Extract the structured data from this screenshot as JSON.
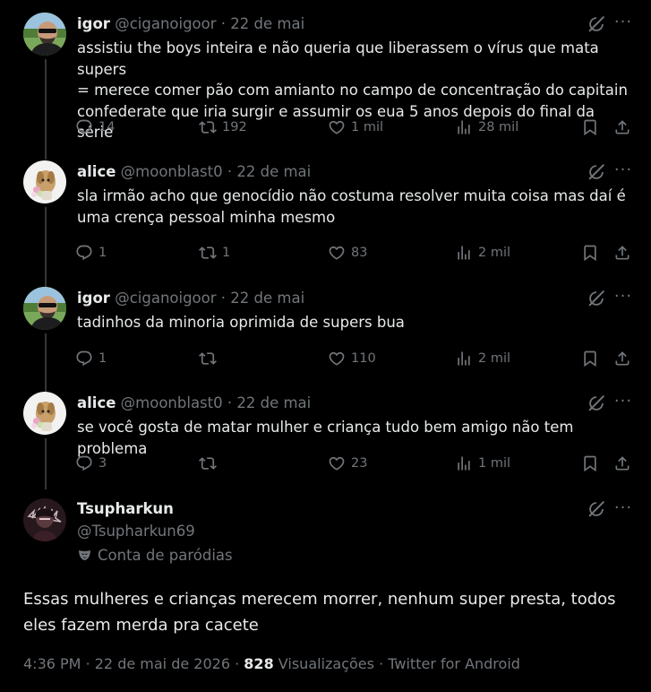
{
  "replies": [
    {
      "name": "igor",
      "handle": "@ciganoigoor",
      "dot": "·",
      "date": "22 de mai",
      "avatar": "avatar-igor",
      "lines": [
        "assistiu the boys inteira e não queria que liberassem o vírus que mata supers",
        "= merece comer pão com amianto no campo de concentração do capitain",
        "confederate que iria surgir e assumir os eua 5 anos depois do final da série"
      ],
      "replies_count": "14",
      "reposts": "192",
      "likes": "1 mil",
      "views": "28 mil"
    },
    {
      "name": "alice",
      "handle": "@moonblast0",
      "dot": "·",
      "date": "22 de mai",
      "avatar": "avatar-alice",
      "lines": [
        "sla irmão acho que genocídio não costuma resolver muita coisa mas daí é",
        "uma crença pessoal minha mesmo"
      ],
      "replies_count": "1",
      "reposts": "1",
      "likes": "83",
      "views": "2 mil"
    },
    {
      "name": "igor",
      "handle": "@ciganoigoor",
      "dot": "·",
      "date": "22 de mai",
      "avatar": "avatar-igor",
      "lines": [
        "tadinhos da minoria oprimida de supers bua"
      ],
      "replies_count": "1",
      "reposts": "",
      "likes": "110",
      "views": "2 mil"
    },
    {
      "name": "alice",
      "handle": "@moonblast0",
      "dot": "·",
      "date": "22 de mai",
      "avatar": "avatar-alice",
      "lines": [
        "se você gosta de matar mulher e criança tudo bem amigo não tem problema"
      ],
      "replies_count": "3",
      "reposts": "",
      "likes": "23",
      "views": "1 mil"
    }
  ],
  "main": {
    "name": "Tsupharkun",
    "handle": "@Tsupharkun69",
    "parody_label": "Conta de paródias",
    "text_lines": [
      "Essas mulheres e crianças merecem morrer, nenhum super presta, todos",
      "eles fazem merda pra cacete"
    ],
    "time": "4:36 PM",
    "sep1": "·",
    "date": "22 de mai de 2026",
    "sep2": "·",
    "views_count": "828",
    "views_label": "Visualizações",
    "sep3": "·",
    "source": "Twitter for Android"
  },
  "icons": {
    "reply": "reply-bubble-icon",
    "repost": "repost-icon",
    "like": "heart-icon",
    "views": "views-bars-icon",
    "bookmark": "bookmark-icon",
    "share": "share-icon",
    "grok": "grok-icon",
    "more": "more-dots-icon",
    "parody": "theater-mask-icon"
  },
  "colors": {
    "background": "#000000",
    "text": "#e7e9ea",
    "muted": "#71767b",
    "thread_line": "#333639"
  }
}
